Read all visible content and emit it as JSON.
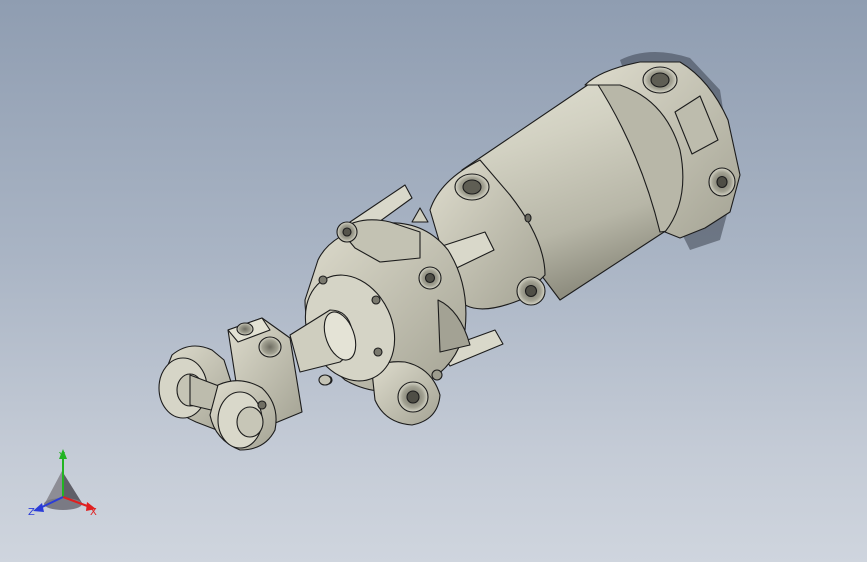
{
  "viewport": {
    "background_top": "#8f9db1",
    "background_bottom": "#cfd5de"
  },
  "model": {
    "body_color": "#c9c8b8",
    "shade_color": "#8e8d7f",
    "edge_color": "#1c1c1c"
  },
  "triad": {
    "x_label": "X",
    "y_label": "Y",
    "z_label": "Z",
    "x_color": "#e02020",
    "y_color": "#22b422",
    "z_color": "#2a3cd8"
  }
}
